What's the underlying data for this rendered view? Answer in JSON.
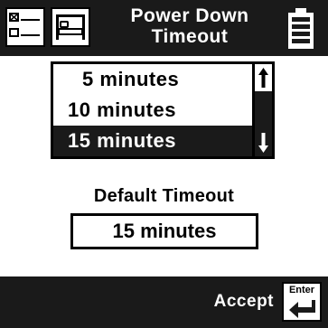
{
  "header": {
    "title_line1": "Power Down",
    "title_line2": "Timeout",
    "icons": [
      "checklist-icon",
      "bed-icon",
      "battery-icon"
    ]
  },
  "timeout_list": {
    "items": [
      "5 minutes",
      "10 minutes",
      "15 minutes"
    ],
    "selected_index": 2
  },
  "default_timeout": {
    "label": "Default Timeout",
    "value": "15 minutes"
  },
  "footer": {
    "accept_label": "Accept",
    "enter_label": "Enter"
  },
  "colors": {
    "bar": "#1a1a1a",
    "background": "#ffffff",
    "text": "#000000"
  }
}
